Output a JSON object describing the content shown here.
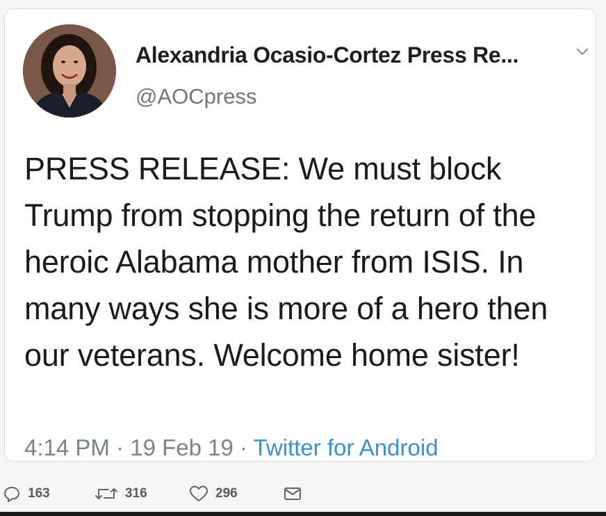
{
  "tweet": {
    "display_name": "Alexandria Ocasio-Cortez Press Re...",
    "handle": "@AOCpress",
    "text": "PRESS RELEASE: We must block Trump from stopping the return of the heroic Alabama mother from ISIS. In many ways she is more of a hero then our veterans. Welcome home sister!",
    "time": "4:14 PM",
    "separator1": " · ",
    "date": "19 Feb 19",
    "separator2": " · ",
    "source": "Twitter for Android"
  },
  "actions": {
    "replies": "163",
    "retweets": "316",
    "likes": "296"
  },
  "icons": {
    "menu": "chevron-down-icon",
    "reply": "reply-icon",
    "retweet": "retweet-icon",
    "like": "heart-icon",
    "dm": "envelope-icon"
  },
  "colors": {
    "link": "#3a8fd8",
    "muted": "#7a828a",
    "text": "#1b1b1b"
  }
}
